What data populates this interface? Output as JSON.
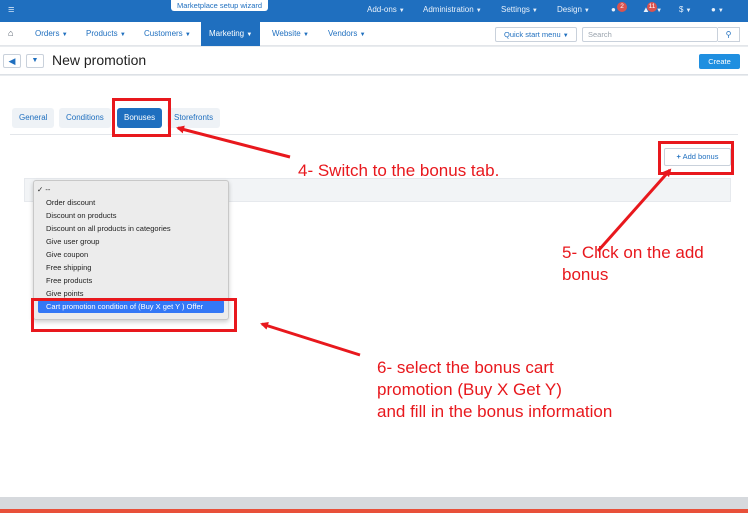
{
  "topbar": {
    "wizard": "Marketplace setup wizard",
    "items": [
      "Add-ons",
      "Administration",
      "Settings",
      "Design"
    ],
    "badges": [
      "2",
      "11"
    ],
    "currency": "$"
  },
  "nav": {
    "items": [
      "Orders",
      "Products",
      "Customers",
      "Marketing",
      "Website",
      "Vendors"
    ],
    "quick_start": "Quick start menu",
    "search_placeholder": "Search"
  },
  "title_bar": {
    "title": "New promotion",
    "create": "Create"
  },
  "tabs": [
    "General",
    "Conditions",
    "Bonuses",
    "Storefronts"
  ],
  "add_bonus": "Add bonus",
  "dropdown": {
    "options": [
      "✓ --",
      "Order discount",
      "Discount on products",
      "Discount on all products in categories",
      "Give user group",
      "Give coupon",
      "Free shipping",
      "Free products",
      "Give points",
      "Cart promotion condition of (Buy X get Y ) Offer"
    ]
  },
  "annotations": {
    "step4": "4- Switch to the bonus tab.",
    "step5_line1": "5- Click on the add",
    "step5_line2": "bonus",
    "step6_line1": "6- select the bonus cart",
    "step6_line2": "promotion (Buy X Get Y)",
    "step6_line3": "and fill in the bonus information"
  },
  "colors": {
    "primary": "#1f6fbf",
    "annotation": "#e8181d",
    "selection": "#3478f6"
  }
}
